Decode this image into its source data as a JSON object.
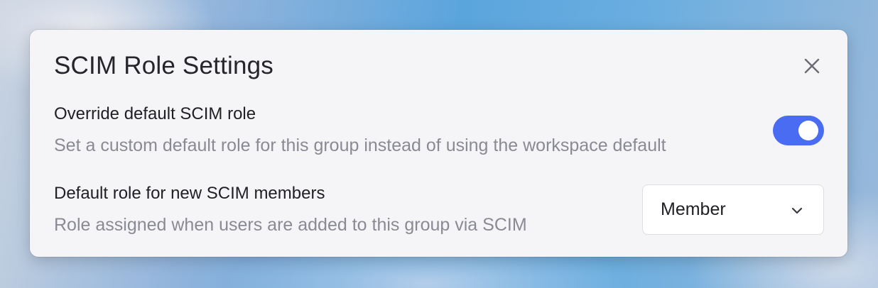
{
  "dialog": {
    "title": "SCIM Role Settings",
    "close_icon": "close-icon"
  },
  "override_setting": {
    "title": "Override default SCIM role",
    "description": "Set a custom default role for this group instead of using the workspace default",
    "toggle_on": true,
    "toggle_color": "#4a6cf2"
  },
  "default_role_setting": {
    "title": "Default role for new SCIM members",
    "description": "Role assigned when users are added to this group via SCIM",
    "selected_value": "Member",
    "chevron_icon": "chevron-down-icon"
  }
}
